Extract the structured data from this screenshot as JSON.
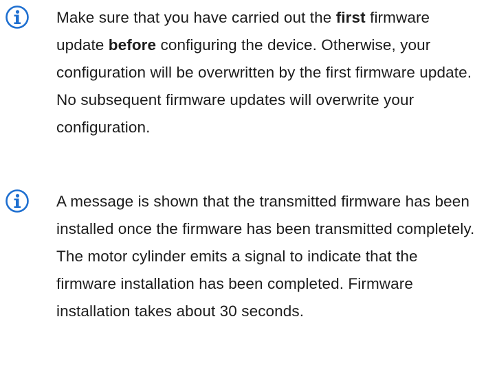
{
  "notes": [
    {
      "icon": "info-icon",
      "segments": [
        {
          "text": "Make sure that you have carried out the ",
          "bold": false
        },
        {
          "text": "first",
          "bold": true
        },
        {
          "text": " firmware update ",
          "bold": false
        },
        {
          "text": "before",
          "bold": true
        },
        {
          "text": " configuring the device. Otherwise, your configuration will be overwritten by the first firmware update. No subsequent firmware updates will overwrite your configuration.",
          "bold": false
        }
      ]
    },
    {
      "icon": "info-icon",
      "segments": [
        {
          "text": "A message is shown that the transmitted firmware has been installed once the firmware has been transmitted completely. The motor cylinder emits a signal to indicate that the firmware installation has been completed. Firmware installation takes about 30 seconds.",
          "bold": false
        }
      ]
    }
  ],
  "colors": {
    "icon": "#1e6fd0",
    "text": "#1c1c1c"
  }
}
